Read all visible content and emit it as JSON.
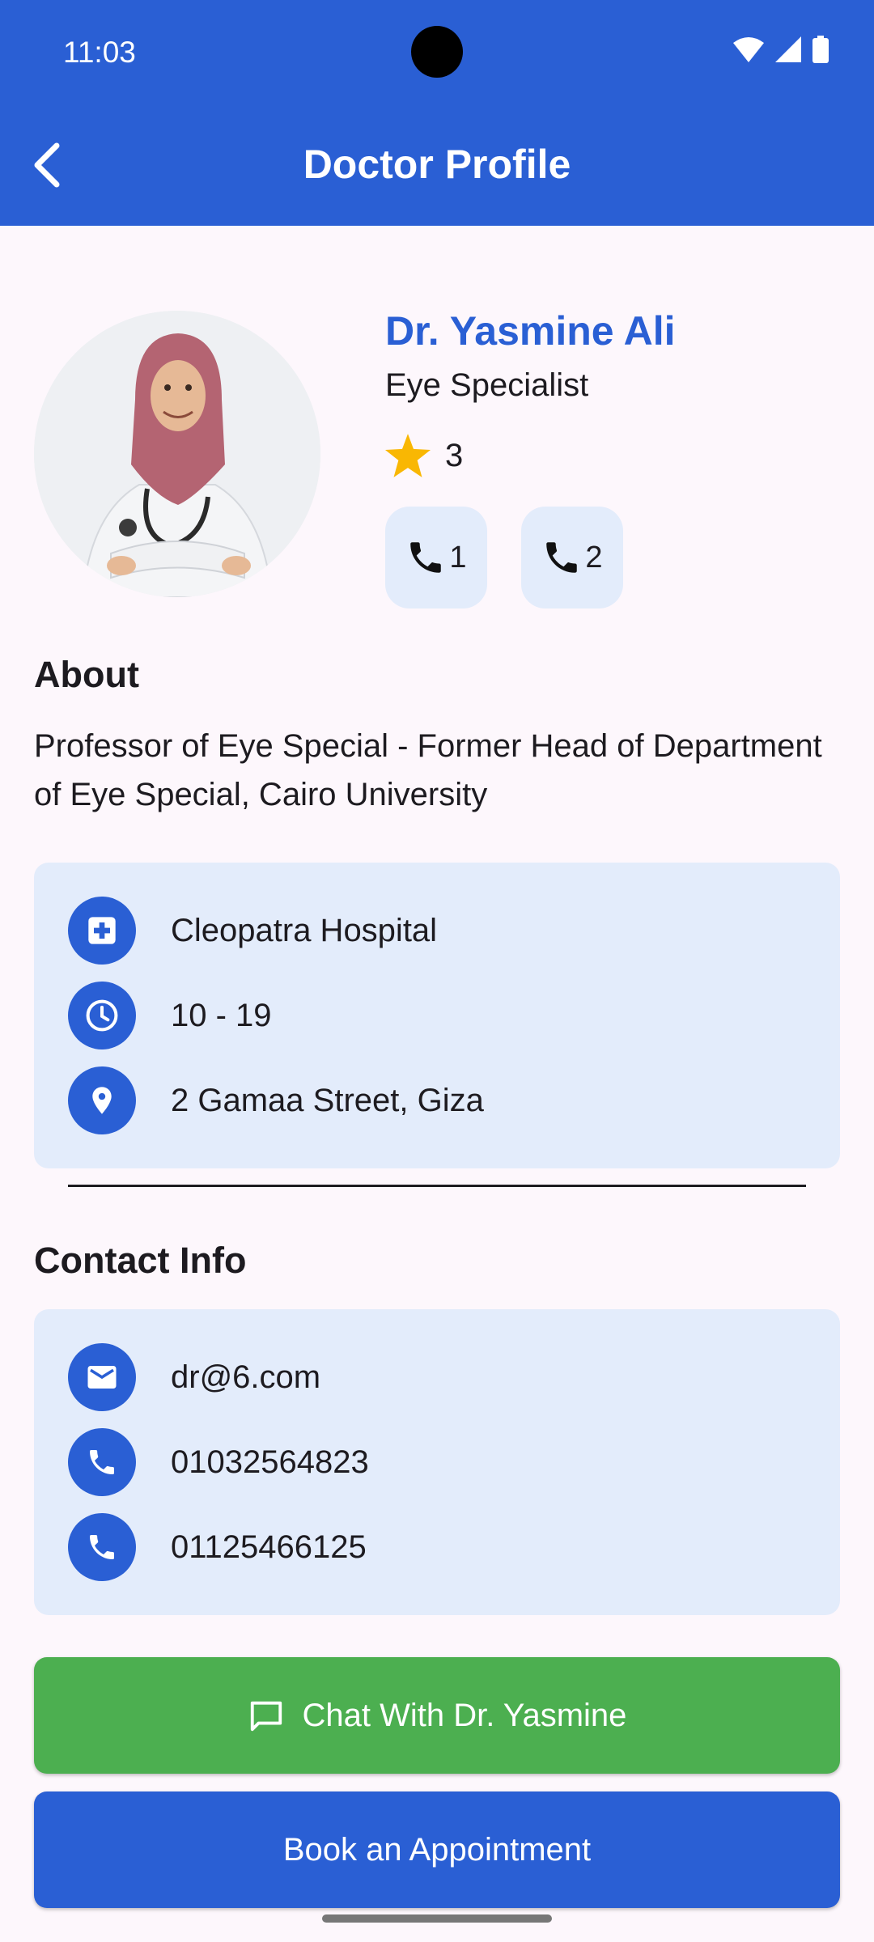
{
  "status_bar": {
    "time": "11:03"
  },
  "app_bar": {
    "title": "Doctor Profile"
  },
  "doctor": {
    "name": "Dr. Yasmine Ali",
    "specialty": "Eye Specialist",
    "rating": "3",
    "call_buttons": [
      "1",
      "2"
    ]
  },
  "about": {
    "heading": "About",
    "text": "Professor of Eye Special - Former Head of Department of Eye Special, Cairo University"
  },
  "details": {
    "hospital": "Cleopatra Hospital",
    "hours": "10 - 19",
    "address": "2 Gamaa Street, Giza"
  },
  "contact": {
    "heading": "Contact Info",
    "email": "dr@6.com",
    "phone1": "01032564823",
    "phone2": "01125466125"
  },
  "actions": {
    "chat_label": "Chat With Dr. Yasmine",
    "book_label": "Book an Appointment"
  },
  "colors": {
    "primary": "#2A5FD4",
    "card": "#E3ECFB",
    "chat_button": "#4CAF50",
    "star": "#F9B703",
    "background": "#FDF7FC"
  },
  "icons": [
    "back-arrow-icon",
    "star-icon",
    "phone-icon",
    "hospital-icon",
    "clock-icon",
    "location-pin-icon",
    "email-icon",
    "chat-icon",
    "wifi-icon",
    "signal-icon",
    "battery-icon"
  ]
}
